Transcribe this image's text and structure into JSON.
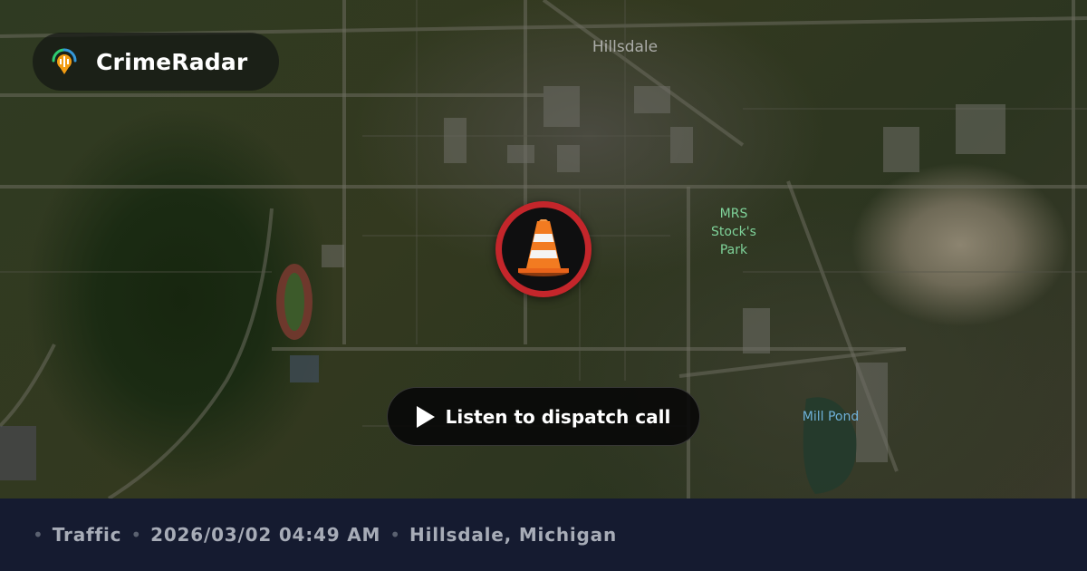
{
  "brand": {
    "name": "CrimeRadar",
    "logo_icon": "radar-pin-logo-icon",
    "accent_colors": [
      "#2ecc71",
      "#f39c12",
      "#e74c3c",
      "#3498db"
    ]
  },
  "map": {
    "labels": {
      "town": "Hillsdale",
      "park": "MRS Stock's Park",
      "pond": "Mill Pond"
    }
  },
  "marker": {
    "icon": "traffic-cone-icon",
    "ring_color": "#c4262b"
  },
  "action": {
    "play_icon": "play-icon",
    "label": "Listen to dispatch call"
  },
  "footer": {
    "category": "Traffic",
    "datetime": "2026/03/02 04:49 AM",
    "location": "Hillsdale, Michigan",
    "separator": "•"
  }
}
